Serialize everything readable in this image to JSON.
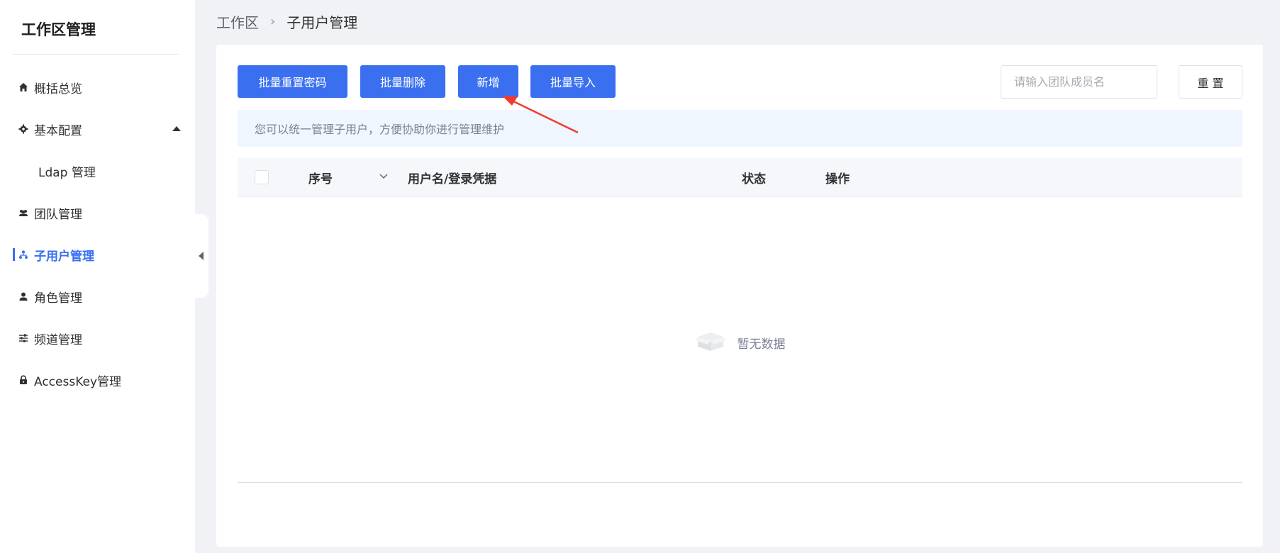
{
  "sidebar": {
    "title": "工作区管理",
    "items": [
      {
        "label": "概括总览",
        "icon": "home-icon"
      },
      {
        "label": "基本配置",
        "icon": "gear-icon"
      },
      {
        "label": "Ldap 管理"
      },
      {
        "label": "团队管理",
        "icon": "team-icon"
      },
      {
        "label": "子用户管理",
        "icon": "sub-user-icon",
        "active": true
      },
      {
        "label": "角色管理",
        "icon": "user-icon"
      },
      {
        "label": "频道管理",
        "icon": "sliders-icon"
      },
      {
        "label": "AccessKey管理",
        "icon": "lock-icon"
      }
    ]
  },
  "breadcrumb": {
    "root": "工作区",
    "current": "子用户管理"
  },
  "toolbar": {
    "batch_reset_password": "批量重置密码",
    "batch_delete": "批量删除",
    "add": "新增",
    "batch_import": "批量导入",
    "search_placeholder": "请输入团队成员名",
    "reset": "重 置"
  },
  "info": "您可以统一管理子用户，方便协助你进行管理维护",
  "table": {
    "columns": [
      "序号",
      "用户名/登录凭据",
      "状态",
      "操作"
    ],
    "empty_text": "暂无数据"
  },
  "colors": {
    "primary": "#3a6ff0",
    "annotation_arrow": "#f03c2e"
  }
}
